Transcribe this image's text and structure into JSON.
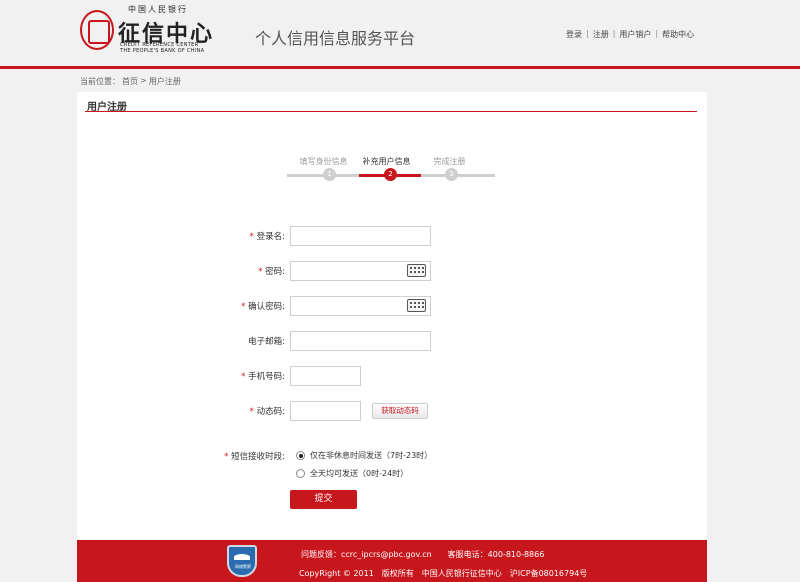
{
  "header": {
    "logo_top": "中国人民银行",
    "logo_main": "征信中心",
    "logo_sub1": "CREDIT REFERENCE CENTER",
    "logo_sub2": "THE PEOPLE'S BANK OF CHINA",
    "platform_title": "个人信用信息服务平台",
    "nav": [
      "登录",
      "注册",
      "用户销户",
      "帮助中心"
    ],
    "nav_sep": "|"
  },
  "breadcrumb": {
    "prefix": "当前位置：",
    "home": "首页",
    "sep": ">",
    "current": "用户注册"
  },
  "card": {
    "title": "用户注册"
  },
  "steps": [
    {
      "label": "填写身份信息",
      "number": "1",
      "active": false
    },
    {
      "label": "补充用户信息",
      "number": "2",
      "active": true
    },
    {
      "label": "完成注册",
      "number": "3",
      "active": false
    }
  ],
  "form": {
    "required_mark": "*",
    "login_name_label": "登录名:",
    "login_name_value": "",
    "password_label": "密码:",
    "password_value": "",
    "confirm_password_label": "确认密码:",
    "confirm_password_value": "",
    "email_label": "电子邮箱:",
    "email_value": "",
    "phone_label": "手机号码:",
    "phone_value": "",
    "code_label": "动态码:",
    "code_value": "",
    "get_code_button": "获取动态码",
    "sms_time_label": "短信接收时段:",
    "sms_options": [
      {
        "label": "仅在非休息时间发送（7时-23时）",
        "checked": true
      },
      {
        "label": "全天均可发送（0时-24时）",
        "checked": false
      }
    ],
    "submit_label": "提交"
  },
  "footer": {
    "badge_text": "网络警察",
    "line1": "问题反馈：ccrc_ipcrs@pbc.gov.cn　　客服电话：400-810-8866",
    "line2": "CopyRight © 2011　版权所有　中国人民银行征信中心　沪ICP备08016794号"
  },
  "colors": {
    "accent": "#c8161d",
    "inactive_step": "#cfcfcf"
  }
}
